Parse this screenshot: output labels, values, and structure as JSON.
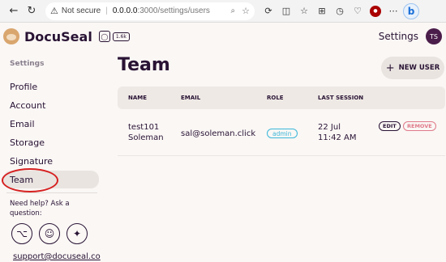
{
  "browser": {
    "back_icon": "←",
    "refresh_icon": "↻",
    "security_label": "Not secure",
    "url_host": "0.0.0.0",
    "url_path": ":3000/settings/users",
    "more_icon": "⋯",
    "profile_icon": "b"
  },
  "header": {
    "brand": "DocuSeal",
    "github_icon": "◯",
    "github_count": "1.6k",
    "settings_label": "Settings",
    "avatar_initials": "TS"
  },
  "sidebar": {
    "heading": "Settings",
    "items": [
      {
        "label": "Profile"
      },
      {
        "label": "Account"
      },
      {
        "label": "Email"
      },
      {
        "label": "Storage"
      },
      {
        "label": "Signature"
      },
      {
        "label": "Team"
      }
    ],
    "active_item": "Team",
    "help_text": "Need help? Ask a question:",
    "support_email": "support@docuseal.co"
  },
  "main": {
    "title": "Team",
    "new_user_label": "NEW USER",
    "table": {
      "headers": [
        "NAME",
        "EMAIL",
        "ROLE",
        "LAST SESSION"
      ],
      "rows": [
        {
          "name_line1": "test101",
          "name_line2": "Soleman",
          "email": "sal@soleman.click",
          "role": "admin",
          "session_line1": "22 Jul",
          "session_line2": "11:42 AM",
          "edit_label": "EDIT",
          "remove_label": "REMOVE"
        }
      ]
    }
  },
  "colors": {
    "background": "#faf7f5",
    "text": "#291334",
    "role_badge": "#3ab7d8",
    "remove": "#e07a8a",
    "annotation": "#d62020"
  }
}
